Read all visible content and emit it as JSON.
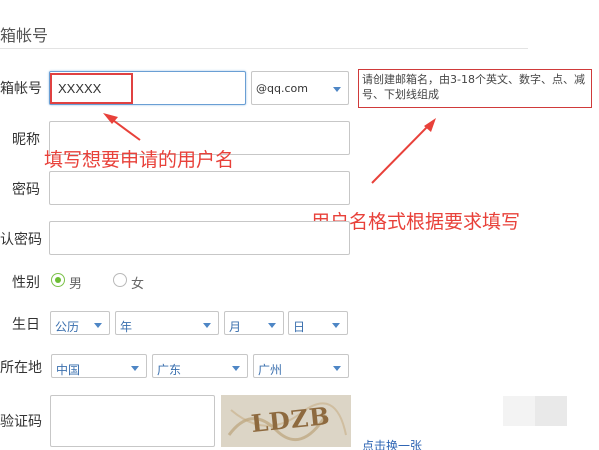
{
  "section": {
    "title": "箱帐号"
  },
  "form": {
    "email": {
      "label": "箱帐号",
      "value": "XXXXX",
      "domain_value": "@qq.com"
    },
    "hint": {
      "text": "请创建邮箱名，由3-18个英文、数字、点、减号、下划线组成"
    },
    "nickname": {
      "label": "昵称"
    },
    "password": {
      "label": "密码"
    },
    "confirm_password": {
      "label": "认密码"
    },
    "gender": {
      "label": "性别",
      "male": "男",
      "female": "女",
      "selected": "男"
    },
    "birthday": {
      "label": "生日",
      "calendar": "公历",
      "year": "年",
      "month": "月",
      "day": "日"
    },
    "location": {
      "label": "所在地",
      "country": "中国",
      "province": "广东",
      "city": "广州"
    },
    "captcha": {
      "label": "验证码",
      "image_text": "LDZB",
      "refresh_link": "点击换一张"
    }
  },
  "annotations": {
    "username_note": "填写想要申请的用户名",
    "format_note": "用户名格式根据要求填写",
    "color": "#e8413a"
  }
}
